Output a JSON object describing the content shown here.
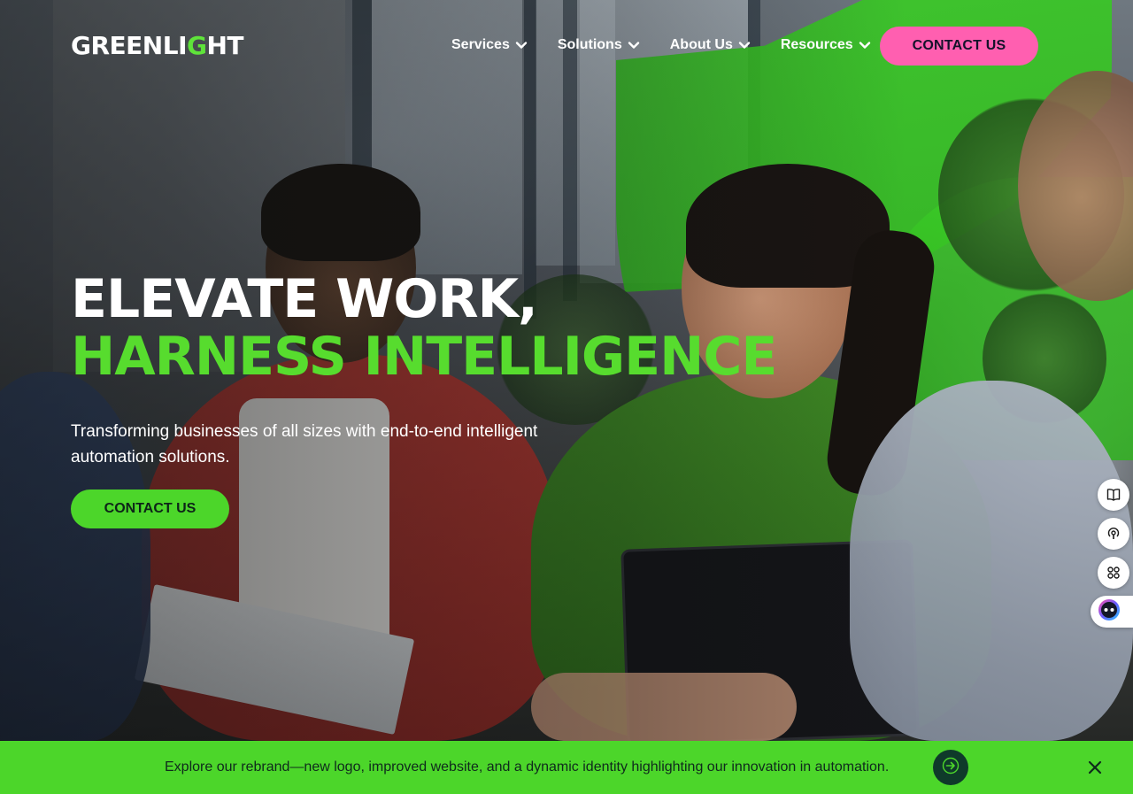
{
  "brand": {
    "logo_text_a": "GREENLI",
    "logo_text_g": "G",
    "logo_text_b": "HT",
    "primary_green": "#4cd62a",
    "accent_pink": "#ff5fb0",
    "dark_teal": "#0f3a2a"
  },
  "nav": {
    "items": [
      {
        "label": "Services",
        "icon": "chevron-down-icon"
      },
      {
        "label": "Solutions",
        "icon": "chevron-down-icon"
      },
      {
        "label": "About Us",
        "icon": "chevron-down-icon"
      },
      {
        "label": "Resources",
        "icon": "chevron-down-icon"
      }
    ],
    "cta_label": "CONTACT US"
  },
  "hero": {
    "headline_line1": "ELEVATE WORK,",
    "headline_line2": "HARNESS INTELLIGENCE",
    "subtext": "Transforming businesses of all sizes with end-to-end intelligent automation solutions.",
    "cta_label": "CONTACT US"
  },
  "side_tools": [
    {
      "icon": "book-icon"
    },
    {
      "icon": "podcast-icon"
    },
    {
      "icon": "command-icon"
    },
    {
      "icon": "chatbot-icon"
    }
  ],
  "banner": {
    "text": "Explore our rebrand—new logo, improved website, and a dynamic identity highlighting our innovation in automation.",
    "arrow_icon": "arrow-right-icon",
    "close_icon": "close-icon"
  }
}
